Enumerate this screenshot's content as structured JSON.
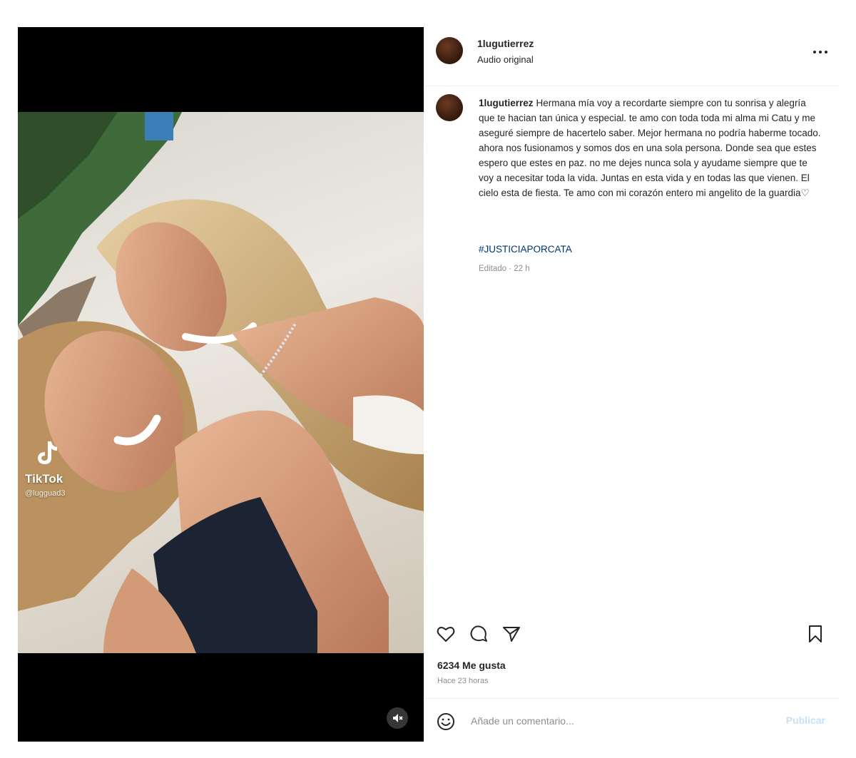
{
  "post": {
    "username": "1lugutierrez",
    "subtitle": "Audio original",
    "more_icon": "more-horizontal-icon"
  },
  "media": {
    "watermark_name": "TikTok",
    "watermark_handle": "@lugguad3",
    "mute_icon": "speaker-muted-icon"
  },
  "caption": {
    "username": "1lugutierrez",
    "text": "Hermana mía voy a recordarte siempre con tu sonrisa y alegría que te hacian tan única y especial. te amo con toda toda mi alma mi Catu y me aseguré siempre de hacertelo saber. Mejor hermana no podría haberme tocado. ahora nos fusionamos y somos dos en una sola persona. Donde sea que estes espero que estes en paz. no me dejes nunca sola y ayudame siempre que te voy a necesitar toda la vida. Juntas en esta vida y en todas las que vienen. El cielo esta de fiesta. Te amo con mi corazón entero mi angelito de la guardia♡",
    "hashtag": "#JUSTICIAPORCATA",
    "edited": "Editado · 22 h"
  },
  "actions": {
    "like_icon": "heart-icon",
    "comment_icon": "comment-icon",
    "share_icon": "send-icon",
    "save_icon": "bookmark-icon"
  },
  "stats": {
    "likes": "6234 Me gusta",
    "time": "Hace 23 horas"
  },
  "comment": {
    "placeholder": "Añade un comentario...",
    "publish": "Publicar",
    "emoji_icon": "emoji-icon"
  }
}
